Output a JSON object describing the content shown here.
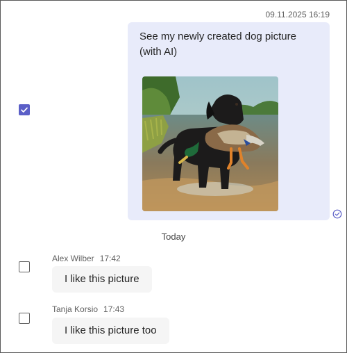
{
  "sent_message": {
    "timestamp": "09.11.2025 16:19",
    "text": "See my newly created dog picture (with AI)",
    "image_icon": "dog-with-duck-photo",
    "status_icon": "read-receipt-icon",
    "selected": true
  },
  "divider": {
    "label": "Today"
  },
  "messages": [
    {
      "author": "Alex Wilber",
      "time": "17:42",
      "text": "I like this picture",
      "selected": false
    },
    {
      "author": "Tanja Korsio",
      "time": "17:43",
      "text": "I like this picture too",
      "selected": false
    }
  ],
  "colors": {
    "accent": "#5b5fc7",
    "sent_bubble": "#e8ebfa",
    "received_bubble": "#f5f5f5"
  }
}
